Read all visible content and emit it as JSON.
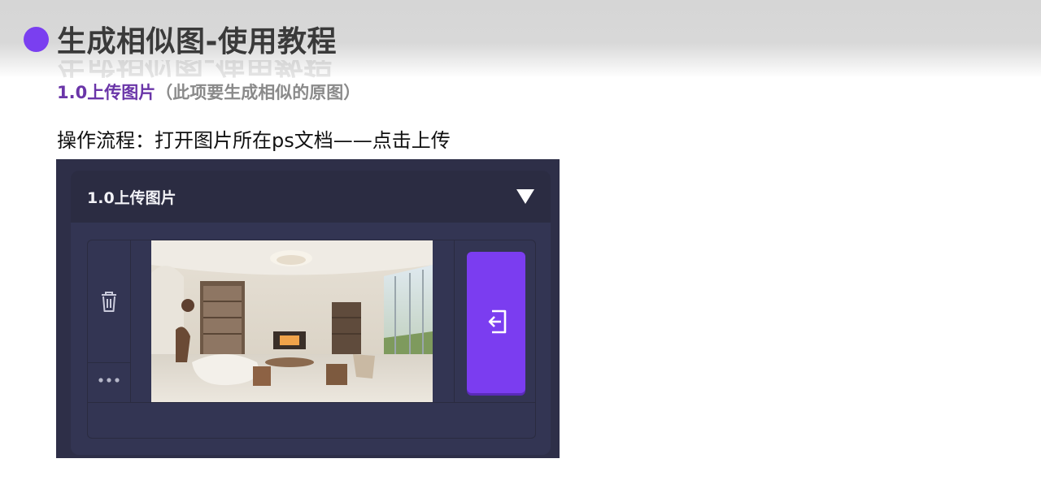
{
  "header": {
    "title": "生成相似图-使用教程",
    "accent_color": "#7a3ff0"
  },
  "section": {
    "heading_main": "1.0上传图片",
    "heading_note": "（此项要生成相似的原图）",
    "flow_text": "操作流程：打开图片所在ps文档——点击上传"
  },
  "panel": {
    "header_label": "1.0上传图片",
    "collapse_icon": "triangle-down-icon",
    "delete_icon": "trash-icon",
    "more_icon": "more-dots-icon",
    "upload_icon": "upload-enter-icon",
    "upload_button_color": "#7b3df0",
    "thumbnail": "interior living room photo"
  }
}
